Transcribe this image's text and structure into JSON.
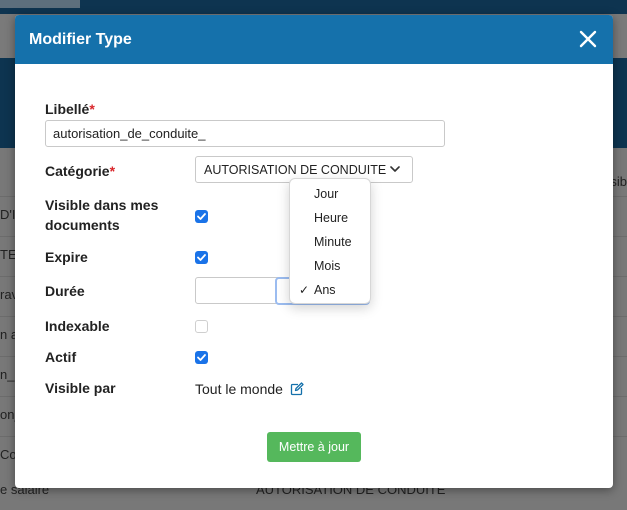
{
  "background": {
    "cells_left": [
      "D'I",
      "TE",
      "rav",
      "n a",
      "n_p",
      "on_",
      "Co"
    ],
    "cell_right_header": "sib",
    "bottom_left": "e salaire",
    "bottom_mid": "AUTORISATION DE CONDUITE"
  },
  "modal": {
    "title": "Modifier Type",
    "close_icon": "close-icon",
    "fields": {
      "libelle_label": "Libellé",
      "libelle_required": "*",
      "libelle_value": "autorisation_de_conduite_",
      "categorie_label": "Catégorie",
      "categorie_required": "*",
      "categorie_value": "AUTORISATION DE CONDUITE",
      "visible_docs_label_1": "Visible dans mes",
      "visible_docs_label_2": "documents",
      "visible_docs_checked": true,
      "expire_label": "Expire",
      "expire_checked": true,
      "duree_label": "Durée",
      "duree_value": "",
      "indexable_label": "Indexable",
      "indexable_checked": false,
      "actif_label": "Actif",
      "actif_checked": true,
      "visible_par_label": "Visible par",
      "visible_par_value": "Tout le monde"
    },
    "submit_label": "Mettre à jour"
  },
  "duration_dropdown": {
    "options": [
      "Jour",
      "Heure",
      "Minute",
      "Mois",
      "Ans"
    ],
    "selected": "Ans",
    "check_glyph": "✓"
  },
  "colors": {
    "header": "#1571ab",
    "accent_checkbox": "#1a73e8",
    "submit": "#55b85c",
    "required": "#d9262b"
  }
}
